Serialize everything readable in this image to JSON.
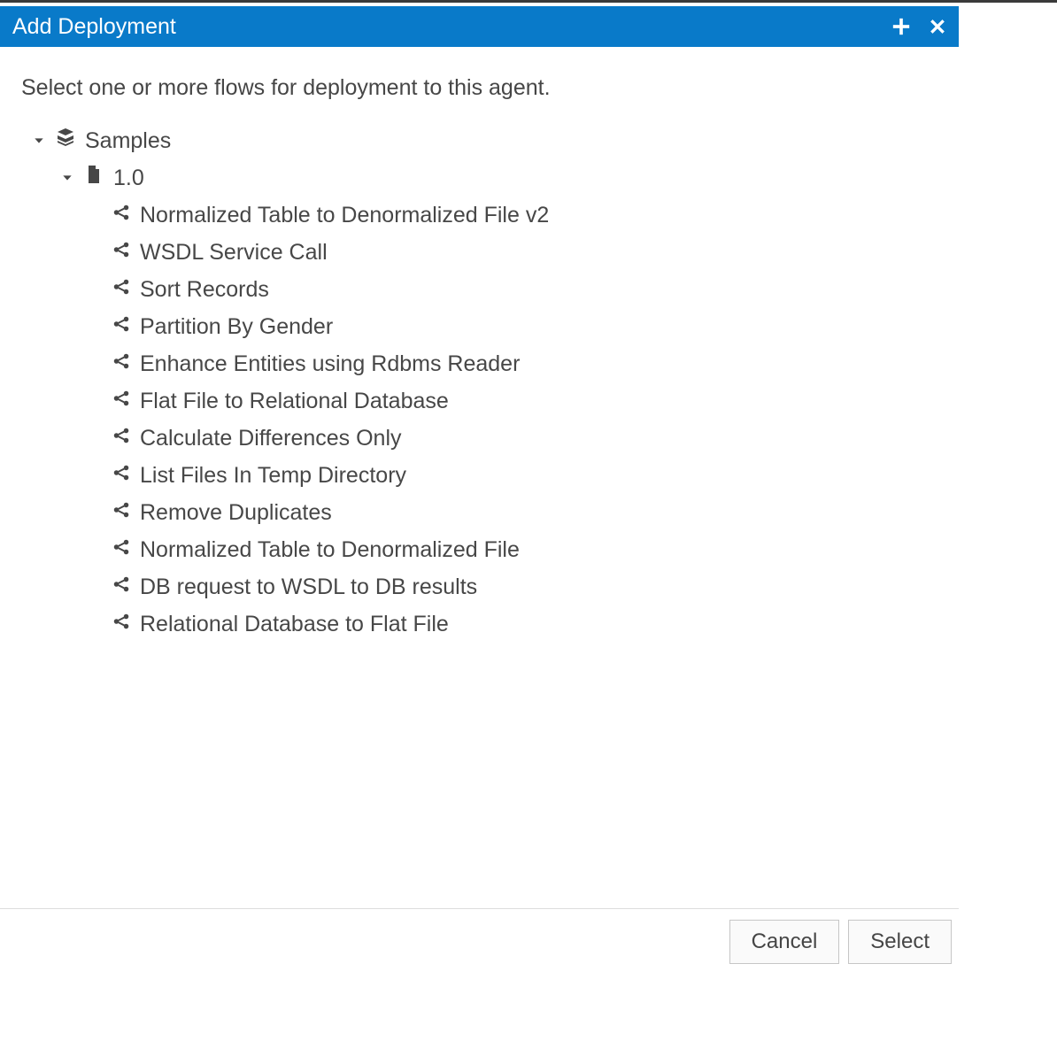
{
  "header": {
    "title": "Add Deployment"
  },
  "instruction": "Select one or more flows for deployment to this agent.",
  "tree": {
    "root_label": "Samples",
    "version_label": "1.0",
    "flows": [
      "Normalized Table to Denormalized File v2",
      "WSDL Service Call",
      "Sort Records",
      "Partition By Gender",
      "Enhance Entities using Rdbms Reader",
      "Flat File to Relational Database",
      "Calculate Differences Only",
      "List Files In Temp Directory",
      "Remove Duplicates",
      "Normalized Table to Denormalized File",
      "DB request to WSDL to DB results",
      "Relational Database to Flat File"
    ]
  },
  "footer": {
    "cancel_label": "Cancel",
    "select_label": "Select"
  }
}
